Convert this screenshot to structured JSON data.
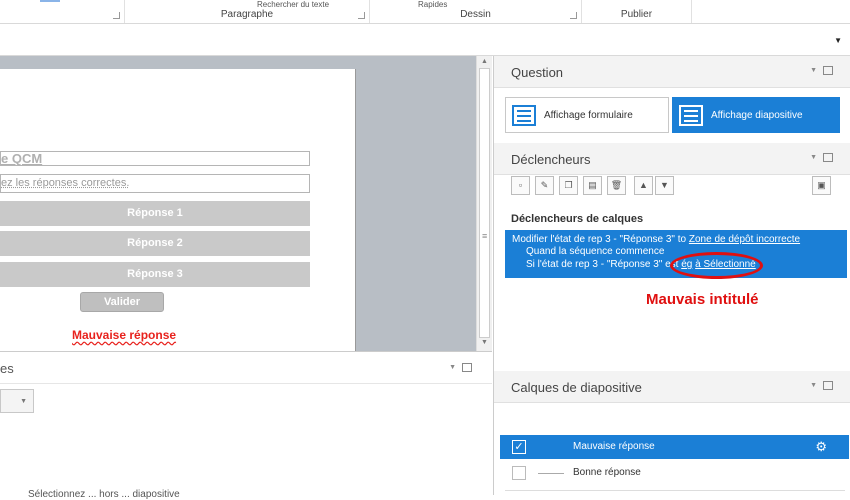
{
  "ribbon": {
    "groups": [
      {
        "label": ""
      },
      {
        "label": "Paragraphe"
      },
      {
        "label": "Dessin"
      },
      {
        "label": "Publier"
      }
    ],
    "cut_texts": {
      "search": "Rechercher du texte",
      "shapes": "Rapides"
    }
  },
  "slide": {
    "title_text": "e QCM",
    "instruction_text": "ez les réponses correctes.",
    "answers": [
      "Réponse 1",
      "Réponse 2",
      "Réponse 3"
    ],
    "submit_label": "Valider",
    "wrong_label": "Mauvaise réponse"
  },
  "bottom_pane": {
    "header": "es",
    "trailing_text": "Sélectionnez ... hors ... diapositive"
  },
  "right_panel": {
    "question_header": "Question",
    "view_form_label": "Affichage formulaire",
    "view_slide_label": "Affichage diapositive",
    "triggers_header": "Déclencheurs",
    "tools": [
      "new-icon",
      "edit-icon",
      "copy-icon",
      "paste-icon",
      "delete-icon",
      "move-up-icon",
      "move-down-icon",
      "slide-icon"
    ],
    "layer_triggers_title": "Déclencheurs de calques",
    "trigger": {
      "line1_prefix": "Modifier l'état de rep 3 - \"Réponse 3\" to ",
      "line1_link": "Zone de dépôt incorrecte",
      "line2": "Quand la séquence commence",
      "line3_prefix": "Si l'état de rep 3 - \"Réponse 3\" est ",
      "line3_link1": "ég",
      "line3_link2": "à Sélectionné"
    },
    "annotation": "Mauvais intitulé",
    "layers_header": "Calques de diapositive",
    "layers": [
      {
        "name": "Mauvaise réponse",
        "selected": true
      },
      {
        "name": "Bonne réponse",
        "selected": false
      }
    ]
  }
}
